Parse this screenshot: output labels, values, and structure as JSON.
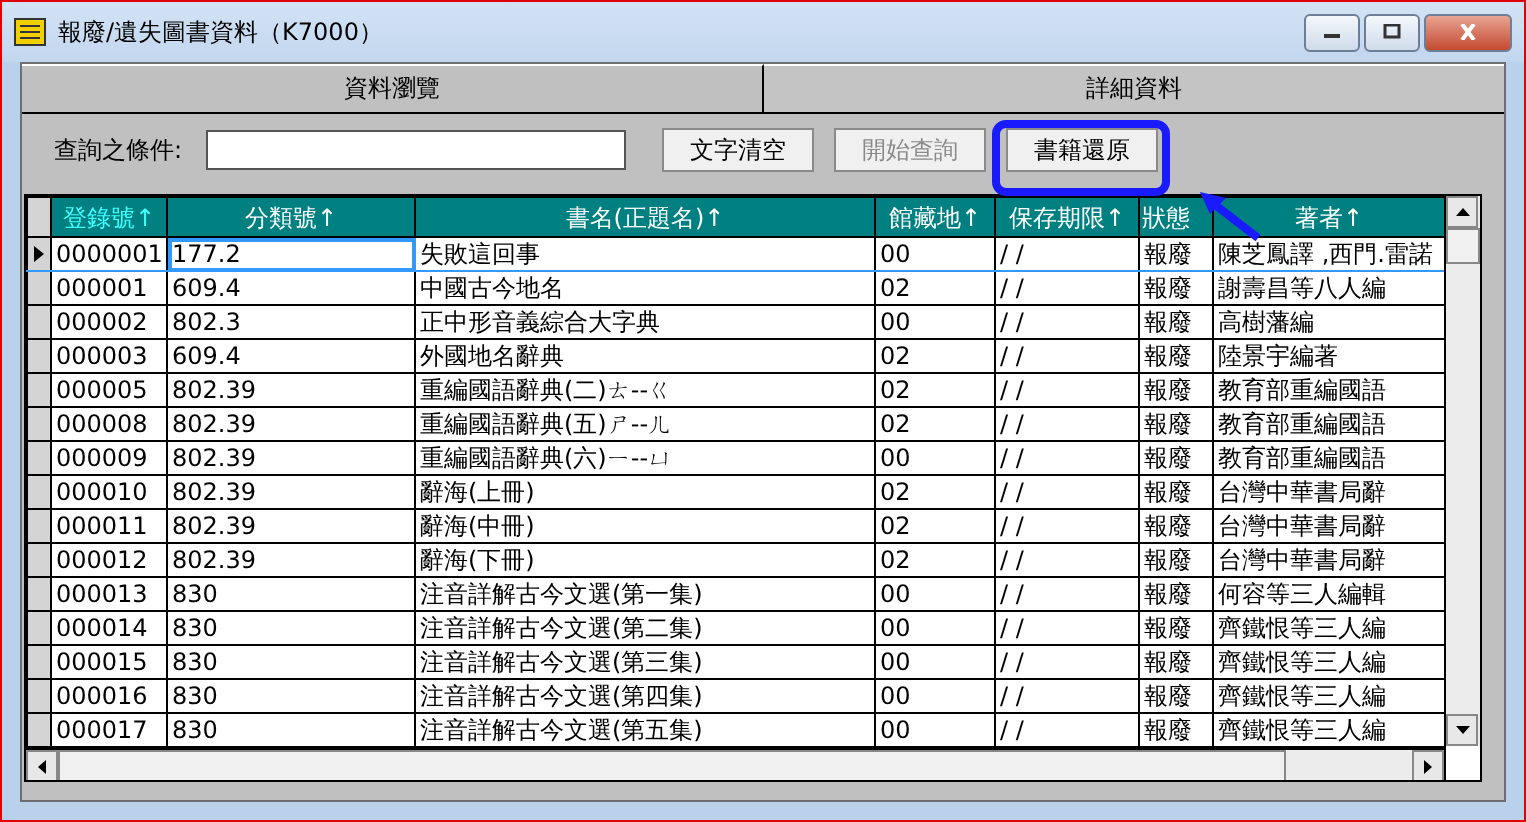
{
  "window": {
    "title": "報廢/遺失圖書資料（K7000）"
  },
  "tabs": [
    {
      "label": "資料瀏覽",
      "selected": true
    },
    {
      "label": "詳細資料",
      "selected": false
    }
  ],
  "query": {
    "label": "查詢之條件:"
  },
  "buttons": [
    {
      "label": "文字清空",
      "disabled": false,
      "highlighted": false
    },
    {
      "label": "開始查詢",
      "disabled": true,
      "highlighted": false
    },
    {
      "label": "書籍還原",
      "disabled": false,
      "highlighted": true
    }
  ],
  "table": {
    "columns": [
      {
        "label": "登錄號↑",
        "sorted": true
      },
      {
        "label": "分類號↑",
        "sorted": false
      },
      {
        "label": "書名(正題名)↑",
        "sorted": false
      },
      {
        "label": "館藏地↑",
        "sorted": false
      },
      {
        "label": "保存期限↑",
        "sorted": false
      },
      {
        "label": "狀態",
        "sorted": false
      },
      {
        "label": "著者↑",
        "sorted": false
      }
    ],
    "rows": [
      {
        "current": true,
        "cells": [
          "0000001",
          "177.2",
          "失敗這回事",
          "00",
          "/   /",
          "報廢",
          "陳芝鳳譯 ,西門.雷諾"
        ]
      },
      {
        "current": false,
        "cells": [
          "000001",
          "609.4",
          "中國古今地名",
          "02",
          "/   /",
          "報廢",
          "謝壽昌等八人編"
        ]
      },
      {
        "current": false,
        "cells": [
          "000002",
          "802.3",
          "正中形音義綜合大字典",
          "00",
          "/   /",
          "報廢",
          "高樹藩編"
        ]
      },
      {
        "current": false,
        "cells": [
          "000003",
          "609.4",
          "外國地名辭典",
          "02",
          "/   /",
          "報廢",
          "陸景宇編著"
        ]
      },
      {
        "current": false,
        "cells": [
          "000005",
          "802.39",
          "重編國語辭典(二)ㄊ--ㄍ",
          "02",
          "/   /",
          "報廢",
          "教育部重編國語"
        ]
      },
      {
        "current": false,
        "cells": [
          "000008",
          "802.39",
          "重編國語辭典(五)ㄕ--ㄦ",
          "02",
          "/   /",
          "報廢",
          "教育部重編國語"
        ]
      },
      {
        "current": false,
        "cells": [
          "000009",
          "802.39",
          "重編國語辭典(六)ㄧ--ㄩ",
          "00",
          "/   /",
          "報廢",
          "教育部重編國語"
        ]
      },
      {
        "current": false,
        "cells": [
          "000010",
          "802.39",
          "辭海(上冊)",
          "02",
          "/   /",
          "報廢",
          "台灣中華書局辭"
        ]
      },
      {
        "current": false,
        "cells": [
          "000011",
          "802.39",
          "辭海(中冊)",
          "02",
          "/   /",
          "報廢",
          "台灣中華書局辭"
        ]
      },
      {
        "current": false,
        "cells": [
          "000012",
          "802.39",
          "辭海(下冊)",
          "02",
          "/   /",
          "報廢",
          "台灣中華書局辭"
        ]
      },
      {
        "current": false,
        "cells": [
          "000013",
          "830",
          "注音詳解古今文選(第一集)",
          "00",
          "/   /",
          "報廢",
          "何容等三人編輯"
        ]
      },
      {
        "current": false,
        "cells": [
          "000014",
          "830",
          "注音詳解古今文選(第二集)",
          "00",
          "/   /",
          "報廢",
          "齊鐵恨等三人編"
        ]
      },
      {
        "current": false,
        "cells": [
          "000015",
          "830",
          "注音詳解古今文選(第三集)",
          "00",
          "/   /",
          "報廢",
          "齊鐵恨等三人編"
        ]
      },
      {
        "current": false,
        "cells": [
          "000016",
          "830",
          "注音詳解古今文選(第四集)",
          "00",
          "/   /",
          "報廢",
          "齊鐵恨等三人編"
        ]
      },
      {
        "current": false,
        "cells": [
          "000017",
          "830",
          "注音詳解古今文選(第五集)",
          "00",
          "/   /",
          "報廢",
          "齊鐵恨等三人編"
        ]
      }
    ]
  }
}
